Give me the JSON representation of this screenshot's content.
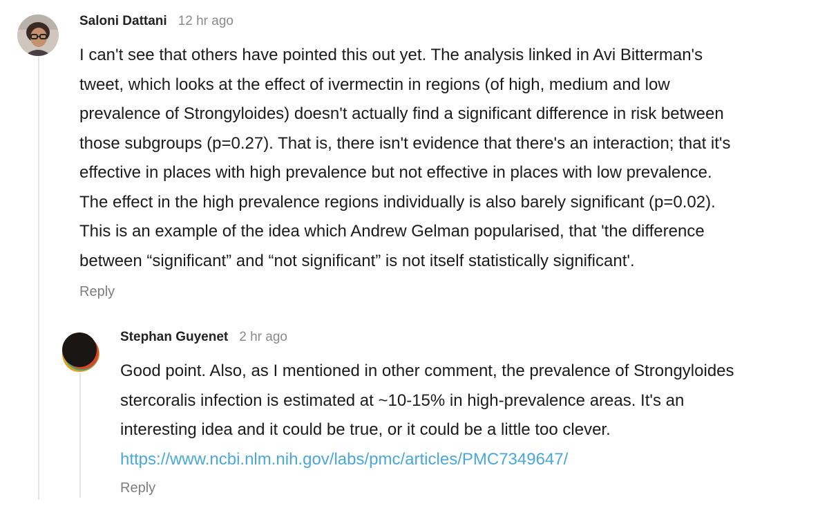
{
  "comments": [
    {
      "author": "Saloni Dattani",
      "time": "12 hr ago",
      "lines": [
        "I can't see that others have pointed this out yet. The analysis linked in Avi Bitterman's",
        "tweet, which looks at the effect of ivermectin in regions (of high, medium and low",
        "prevalence of Strongyloides) doesn't actually find a significant difference in risk between",
        "those subgroups (p=0.27). That is, there isn't evidence that there's an interaction; that it's",
        "effective in places with high prevalence but not effective in places with low prevalence.",
        "The effect in the high prevalence regions individually is also barely significant (p=0.02).",
        "This is an example of the idea which Andrew Gelman popularised, that 'the difference",
        "between “significant” and “not significant” is not itself statistically significant'."
      ],
      "reply_label": "Reply"
    },
    {
      "author": "Stephan Guyenet",
      "time": "2 hr ago",
      "lines": [
        "Good point. Also, as I mentioned in other comment, the prevalence of Strongyloides",
        "stercoralis infection is estimated at ~10-15% in high-prevalence areas. It's an",
        "interesting idea and it could be true, or it could be a little too clever."
      ],
      "link": "https://www.ncbi.nlm.nih.gov/labs/pmc/articles/PMC7349647/",
      "reply_label": "Reply"
    }
  ],
  "colors": {
    "link": "#4aa8d8",
    "muted": "#8a8a8a",
    "thread_line": "#e3e3e3"
  }
}
